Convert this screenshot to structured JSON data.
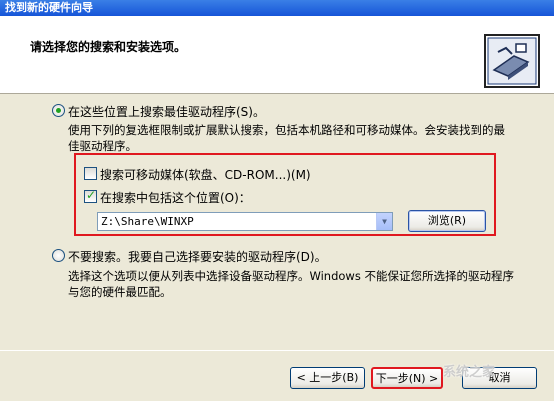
{
  "window": {
    "title": "找到新的硬件向导"
  },
  "header": {
    "title": "请选择您的搜索和安装选项。"
  },
  "options": {
    "search_best": {
      "label": "在这些位置上搜索最佳驱动程序(S)。",
      "description": "使用下列的复选框限制或扩展默认搜索，包括本机路径和可移动媒体。会安装找到的最佳驱动程序。",
      "checked": true
    },
    "removable_media": {
      "label": "搜索可移动媒体(软盘、CD-ROM...)(M)",
      "checked": false
    },
    "include_location": {
      "label": "在搜索中包括这个位置(O)：",
      "checked": true
    },
    "location_value": "Z:\\Share\\WINXP",
    "browse_label": "浏览(R)",
    "dont_search": {
      "label": "不要搜索。我要自己选择要安装的驱动程序(D)。",
      "description": "选择这个选项以便从列表中选择设备驱动程序。Windows 不能保证您所选择的驱动程序与您的硬件最匹配。",
      "checked": false
    }
  },
  "footer": {
    "back_label": "< 上一步(B)",
    "next_label": "下一步(N) >",
    "cancel_label": "取消",
    "watermark": "系统之家"
  },
  "colors": {
    "highlight_border": "#E0181F",
    "title_bar": "#1655D8"
  }
}
